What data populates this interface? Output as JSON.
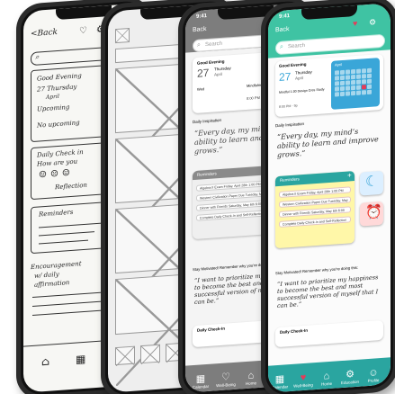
{
  "sketch": {
    "back_label": "<Back",
    "greeting": "Good Evening",
    "date": "27 Thursday",
    "date_sub": "April",
    "upcoming": "Upcoming",
    "no_upcoming": "No upcoming",
    "daily_checkin": "Daily Check in",
    "how_are_you": "How are you",
    "reflection": "Reflection",
    "reminders": "Reminders",
    "encouragement": "Encouragement",
    "w_daily": "w/ daily",
    "affirmation": "affirmation"
  },
  "mid": {
    "time": "9:41",
    "back_label": "Back",
    "search_placeholder": "Search",
    "greeting": "Good Evening",
    "date_num": "27",
    "date_day": "Thursday",
    "date_month": "April",
    "upcoming_row1": "Wed",
    "upcoming_row2": "Mindfulness",
    "time_range": "8:00 PM - 9p",
    "daily_inspiration": "Daily Inspiration",
    "quote": "“Every day, my mind’s ability to learn and improve grows.”",
    "reminders": "Reminders",
    "reminder_items": [
      "Algebra II Exam Friday, April 28th 1:00 PM",
      "Western Civilization Paper Due Tuesday, May 2nd",
      "Dinner with Friends Saturday, May 6th 6:00 PM",
      "Complete Daily Check-In and Self-Reflection"
    ],
    "motivated": "Stay Motivated! Remember why you're doing this:",
    "goal": "“I want to prioritize my happiness to become the best and most successful version of myself that I can be.”",
    "daily_checkin": "Daily Check-In",
    "tabs": [
      "Calendar",
      "Well-Being",
      "Home"
    ]
  },
  "final": {
    "time": "9:41",
    "back_label": "Back",
    "search_placeholder": "Search",
    "greeting": "Good Evening",
    "date_num": "27",
    "date_day": "Thursday",
    "date_month": "April",
    "upcoming_label": "Mindful 1:30 Design Cres Study",
    "time_range": "8:00 PM - 9p",
    "calendar_month": "April",
    "daily_inspiration": "Daily Inspiration",
    "quote": "“Every day, my mind’s ability to learn and improve grows.”",
    "reminders": "Reminders",
    "reminder_items": [
      "Algebra II Exam Friday, April 28th 1:00 PM",
      "Western Civilization Paper Due Tuesday, May 2nd",
      "Dinner with Friends Saturday, May 6th 6:00 PM",
      "Complete Daily Check-In and Self-Reflection"
    ],
    "motivated": "Stay Motivated! Remember why you're doing this:",
    "goal": "“I want to prioritize my happiness to become the best and most successful version of myself that I can be.”",
    "daily_checkin": "Daily Check-In",
    "tabs": [
      "Calendar",
      "Well-Being",
      "Home",
      "Education",
      "Profile"
    ],
    "colors": {
      "accent": "#3fc3a3",
      "tabbar": "#2aa5a0",
      "reminder_bg": "#fff7a8",
      "calendar": "#3aa6d8",
      "heart": "#e23d5a",
      "moon_tile": "#dcefff",
      "alarm_tile": "#ffd9d9"
    }
  }
}
